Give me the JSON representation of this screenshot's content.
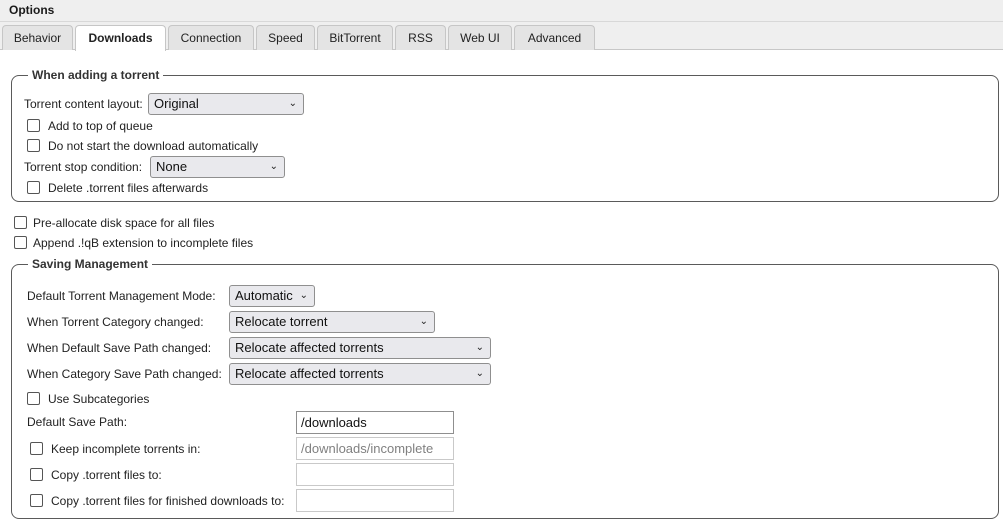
{
  "window": {
    "title": "Options"
  },
  "tabs": [
    {
      "label": "Behavior"
    },
    {
      "label": "Downloads"
    },
    {
      "label": "Connection"
    },
    {
      "label": "Speed"
    },
    {
      "label": "BitTorrent"
    },
    {
      "label": "RSS"
    },
    {
      "label": "Web UI"
    },
    {
      "label": "Advanced"
    }
  ],
  "active_tab": "Downloads",
  "adding": {
    "legend": "When adding a torrent",
    "layout_label": "Torrent content layout:",
    "layout_value": "Original",
    "add_top_label": "Add to top of queue",
    "no_autostart_label": "Do not start the download automatically",
    "stop_condition_label": "Torrent stop condition:",
    "stop_condition_value": "None",
    "delete_torrent_label": "Delete .torrent files afterwards"
  },
  "preallocate_label": "Pre-allocate disk space for all files",
  "append_ext_label": "Append .!qB extension to incomplete files",
  "saving": {
    "legend": "Saving Management",
    "mode_label": "Default Torrent Management Mode:",
    "mode_value": "Automatic",
    "category_changed_label": "When Torrent Category changed:",
    "category_changed_value": "Relocate torrent",
    "default_path_changed_label": "When Default Save Path changed:",
    "default_path_changed_value": "Relocate affected torrents",
    "category_path_changed_label": "When Category Save Path changed:",
    "category_path_changed_value": "Relocate affected torrents",
    "subcategories_label": "Use Subcategories",
    "default_save_path_label": "Default Save Path:",
    "default_save_path_value": "/downloads",
    "keep_incomplete_label": "Keep incomplete torrents in:",
    "keep_incomplete_value": "/downloads/incomplete",
    "copy_torrent_label": "Copy .torrent files to:",
    "copy_torrent_value": "",
    "copy_finished_label": "Copy .torrent files for finished downloads to:",
    "copy_finished_value": ""
  }
}
